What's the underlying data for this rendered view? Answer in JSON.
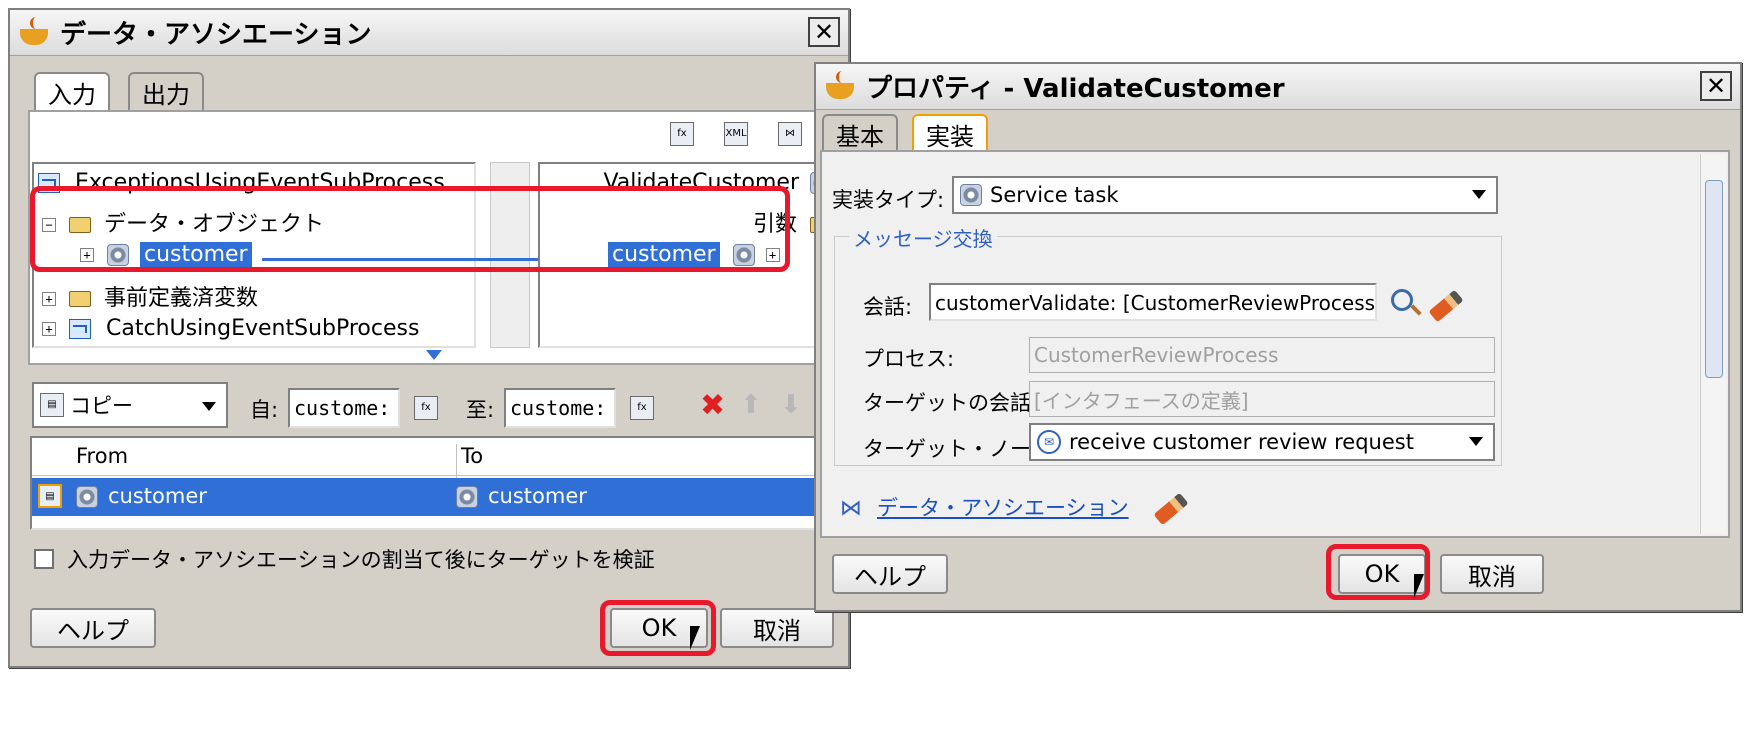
{
  "left_dialog": {
    "title": "データ・アソシエーション",
    "close": "✕",
    "tabs": [
      "入力",
      "出力"
    ],
    "left_tree": {
      "root": "ExceptionsUsingEventSubProcess",
      "data_objects": "データ・オブジェクト",
      "customer": "customer",
      "predefined": "事前定義済変数",
      "catch": "CatchUsingEventSubProcess"
    },
    "right_tree": {
      "root": "ValidateCustomer",
      "arguments": "引数",
      "customer": "customer"
    },
    "toolbar": {
      "copy": "コピー",
      "from_label": "自:",
      "from_value": "custome:",
      "to_label": "至:",
      "to_value": "custome:"
    },
    "table": {
      "headers": [
        "From",
        "To"
      ],
      "rows": [
        {
          "from": "customer",
          "to": "customer"
        }
      ]
    },
    "checkbox": "入力データ・アソシエーションの割当て後にターゲットを検証",
    "help": "ヘルプ",
    "ok": "OK",
    "cancel": "取消"
  },
  "right_dialog": {
    "title": "プロパティ - ValidateCustomer",
    "close": "✕",
    "tabs": [
      "基本",
      "実装"
    ],
    "impl_type_label": "実装タイプ:",
    "impl_type_value": "Service task",
    "group_title": "メッセージ交換",
    "conversation_label": "会話:",
    "conversation_value": "customerValidate: [CustomerReviewProcess]",
    "process_label": "プロセス:",
    "process_value": "CustomerReviewProcess",
    "target_conv_label": "ターゲットの会話:",
    "target_conv_value": "[インタフェースの定義]",
    "target_node_label": "ターゲット・ノード:",
    "target_node_value": "receive customer review request",
    "data_assoc_link": "データ・アソシエーション",
    "help": "ヘルプ",
    "ok": "OK",
    "cancel": "取消"
  }
}
